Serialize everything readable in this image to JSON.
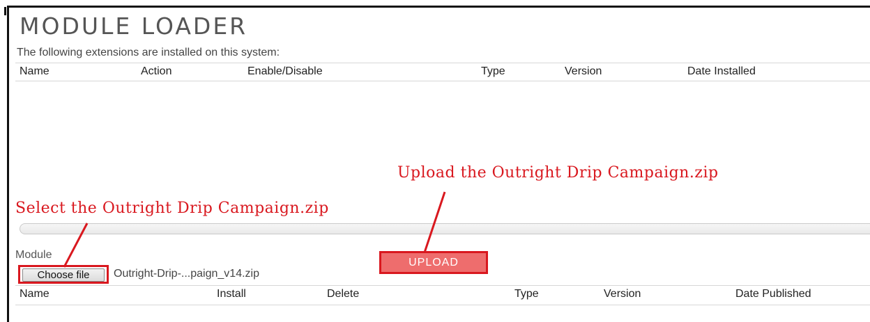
{
  "page": {
    "title": "MODULE LOADER",
    "intro_text": "The following extensions are installed on this system:"
  },
  "installed_table": {
    "headers": [
      "Name",
      "Action",
      "Enable/Disable",
      "Type",
      "Version",
      "Date Installed"
    ]
  },
  "annotations": {
    "upload_note": "Upload the Outright Drip Campaign.zip",
    "select_note": "Select the Outright Drip Campaign.zip"
  },
  "upload_form": {
    "module_label": "Module",
    "choose_file_label": "Choose file",
    "selected_file": "Outright-Drip-...paign_v14.zip",
    "upload_label": "UPLOAD"
  },
  "available_table": {
    "headers": [
      "Name",
      "Install",
      "Delete",
      "Type",
      "Version",
      "Date Published"
    ]
  },
  "colors": {
    "annotation_red": "#d9181f",
    "upload_button": "#ee6d6d"
  }
}
